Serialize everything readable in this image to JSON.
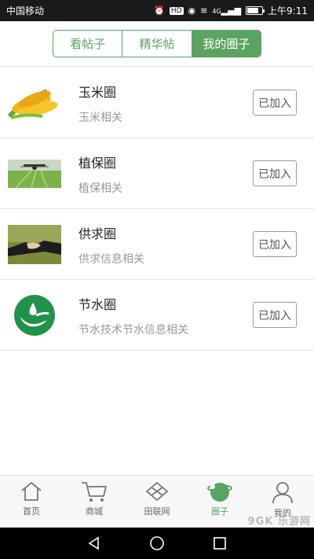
{
  "status_bar": {
    "carrier": "中国移动",
    "signal_label": "4G",
    "time": "上午9:11",
    "hd_badge": "HD"
  },
  "tabs": [
    {
      "label": "看帖子",
      "active": false
    },
    {
      "label": "精华帖",
      "active": false
    },
    {
      "label": "我的圈子",
      "active": true
    }
  ],
  "circles": [
    {
      "title": "玉米圈",
      "desc": "玉米相关",
      "action": "已加入",
      "icon": "corn-image"
    },
    {
      "title": "植保圈",
      "desc": "植保相关",
      "action": "已加入",
      "icon": "drone-field-image"
    },
    {
      "title": "供求圈",
      "desc": "供求信息相关",
      "action": "已加入",
      "icon": "handshake-image"
    },
    {
      "title": "节水圈",
      "desc": "节水技术节水信息相关",
      "action": "已加入",
      "icon": "water-saving-logo"
    }
  ],
  "bottom_nav": [
    {
      "label": "首页",
      "icon": "home-icon",
      "active": false
    },
    {
      "label": "商城",
      "icon": "cart-icon",
      "active": false
    },
    {
      "label": "田联网",
      "icon": "network-icon",
      "active": false
    },
    {
      "label": "圈子",
      "icon": "circle-icon",
      "active": true
    },
    {
      "label": "我的",
      "icon": "person-icon",
      "active": false
    }
  ],
  "watermark": "9GK 乐游网",
  "colors": {
    "accent": "#5aa361",
    "divider": "#e4e4e4"
  }
}
